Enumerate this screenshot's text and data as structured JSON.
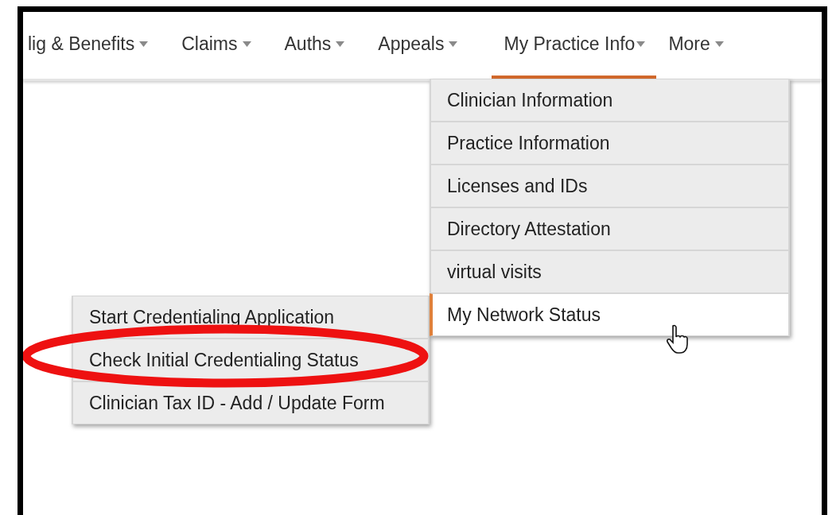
{
  "nav": {
    "items": [
      {
        "label": "lig & Benefits",
        "selected": false
      },
      {
        "label": "Claims",
        "selected": false
      },
      {
        "label": "Auths",
        "selected": false
      },
      {
        "label": "Appeals",
        "selected": false
      },
      {
        "label": "My Practice Info",
        "selected": true
      },
      {
        "label": "More",
        "selected": false
      }
    ]
  },
  "dropdown": {
    "items": [
      {
        "label": "Clinician Information",
        "selected": false
      },
      {
        "label": "Practice Information",
        "selected": false
      },
      {
        "label": "Licenses and IDs",
        "selected": false
      },
      {
        "label": "Directory Attestation",
        "selected": false
      },
      {
        "label": "virtual visits",
        "selected": false
      },
      {
        "label": "My Network Status",
        "selected": true
      }
    ]
  },
  "submenu": {
    "items": [
      {
        "label": "Start Credentialing Application"
      },
      {
        "label": "Check Initial Credentialing Status"
      },
      {
        "label": "Clinician Tax ID - Add / Update Form"
      }
    ]
  },
  "annotation": {
    "kind": "ellipse"
  }
}
